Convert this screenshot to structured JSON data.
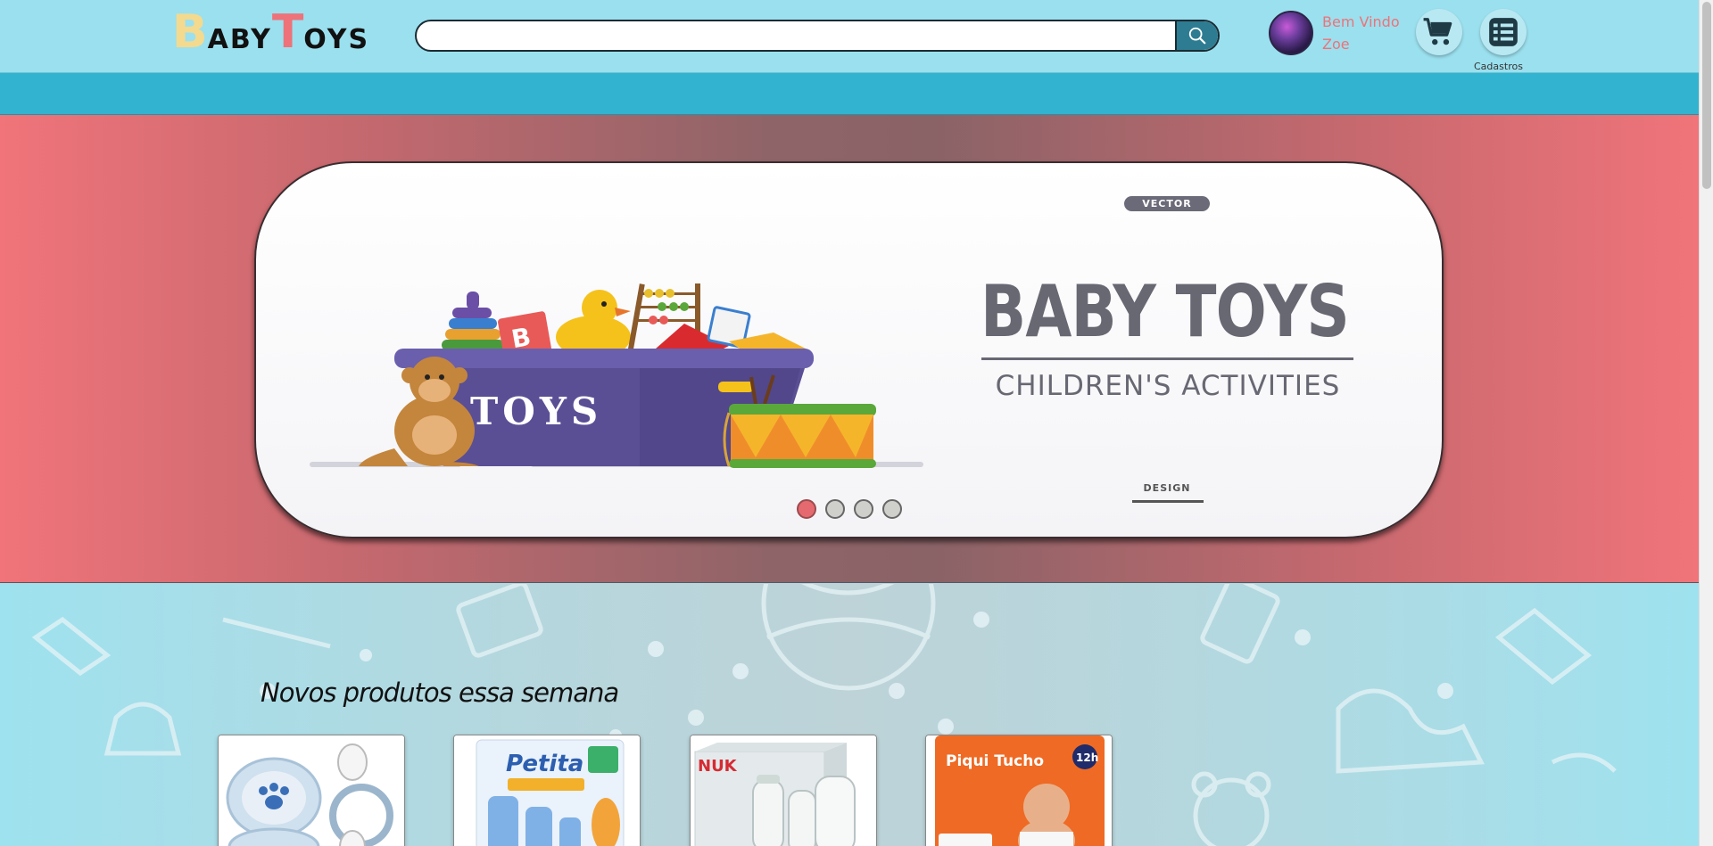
{
  "header": {
    "logo": {
      "b1": "B",
      "r1": "ABY",
      "t1": "T",
      "r2": "OYS",
      "b1_color": "#f3da8f",
      "t1_color": "#ee7279"
    },
    "search": {
      "value": "",
      "placeholder": ""
    },
    "user": {
      "greeting": "Bem Vindo",
      "name": "Zoe"
    },
    "cart_icon": "cart-icon",
    "registrations": {
      "icon": "list-icon",
      "label": "Cadastros"
    }
  },
  "hero": {
    "banner": {
      "vector_tag": "VECTOR",
      "title": "BABY TOYS",
      "subtitle": "CHILDREN'S ACTIVITIES",
      "design_tag": "DESIGN",
      "bin_label": "TOYS"
    },
    "dots": {
      "count": 4,
      "active": 0
    }
  },
  "products_section": {
    "title": "Novos produtos essa semana",
    "products": [
      {
        "name": "pacifier-product",
        "label": ""
      },
      {
        "name": "bottle-kit-product",
        "label": "Petita"
      },
      {
        "name": "nuk-bottle-product",
        "label": "NUK"
      },
      {
        "name": "diaper-product",
        "label": "Piqui Tucho"
      }
    ]
  },
  "colors": {
    "header_bg": "#9be0ee",
    "nav_bg": "#32b3cf",
    "hero_edge": "#f0747a",
    "accent_pink": "#ee7279",
    "search_button": "#2d7c92"
  }
}
